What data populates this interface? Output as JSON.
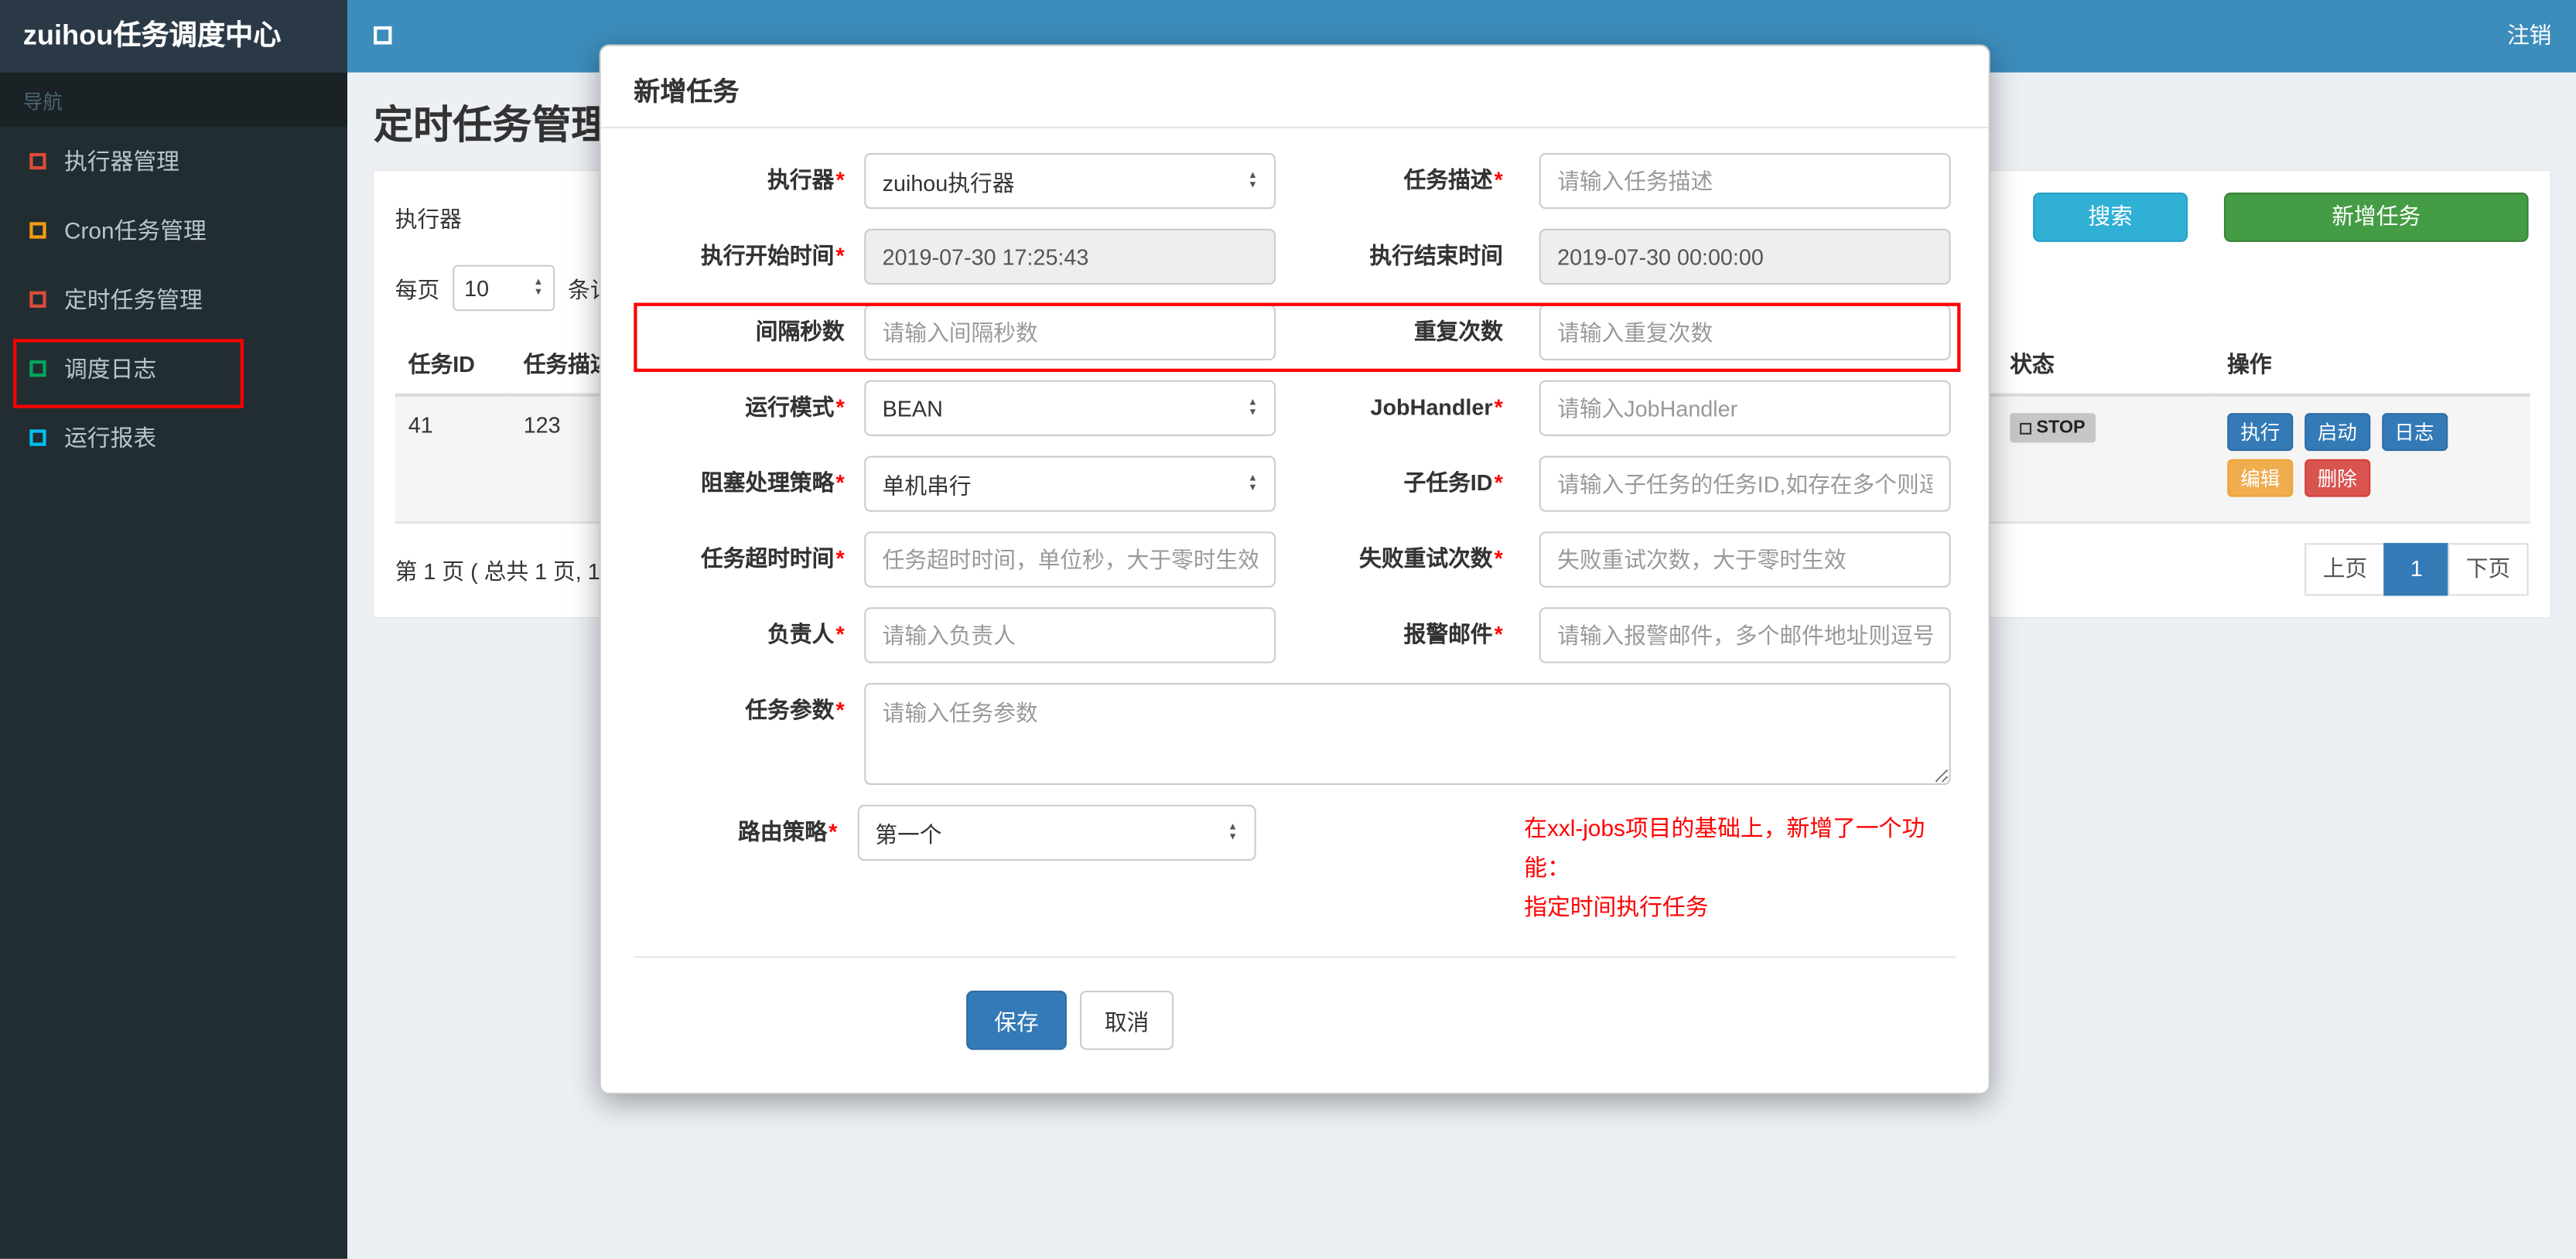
{
  "colors": {
    "navbar": "#3c8dbc",
    "logo_bg": "#2b3947",
    "sidebar_bg": "#222d32",
    "content_bg": "#ecf0f5",
    "primary": "#337ab7",
    "search_button": "#31b0d5",
    "add_button": "#449d44",
    "warning": "#f0ad4e",
    "danger": "#d9534f",
    "annotation": "#ff0000"
  },
  "navbar": {
    "brand": "zuihou任务调度中心",
    "logout": "注销"
  },
  "sidebar": {
    "header": "导航",
    "items": [
      {
        "label": "执行器管理",
        "icon": "square-outline-icon",
        "icon_color": "#dd4b39"
      },
      {
        "label": "Cron任务管理",
        "icon": "square-outline-icon",
        "icon_color": "#f39c12"
      },
      {
        "label": "定时任务管理",
        "icon": "square-outline-icon",
        "icon_color": "#dd4b39",
        "highlighted": true
      },
      {
        "label": "调度日志",
        "icon": "square-outline-icon",
        "icon_color": "#00a65a"
      },
      {
        "label": "运行报表",
        "icon": "square-outline-icon",
        "icon_color": "#00c0ef"
      }
    ]
  },
  "page": {
    "title": "定时任务管理"
  },
  "toolbar": {
    "executor_label": "执行器",
    "search_button": "搜索",
    "add_button": "新增任务",
    "per_page_label": "每页",
    "per_page_value": "10",
    "records_suffix": "条记录"
  },
  "table": {
    "headers": [
      "任务ID",
      "任务描述",
      "状态",
      "操作"
    ],
    "row": {
      "id": "41",
      "desc": "123",
      "status": "STOP",
      "ops": [
        "执行",
        "启动",
        "日志",
        "编辑",
        "删除"
      ]
    }
  },
  "pagination": {
    "summary": "第 1 页 ( 总共 1 页, 1",
    "prev": "上页",
    "current": "1",
    "next": "下页"
  },
  "modal": {
    "title": "新增任务",
    "fields": {
      "executor": {
        "label": "执行器",
        "required": true,
        "value": "zuihou执行器"
      },
      "job_desc": {
        "label": "任务描述",
        "required": true,
        "placeholder": "请输入任务描述"
      },
      "start_time": {
        "label": "执行开始时间",
        "required": true,
        "value": "2019-07-30 17:25:43"
      },
      "end_time": {
        "label": "执行结束时间",
        "required": false,
        "value": "2019-07-30 00:00:00"
      },
      "interval": {
        "label": "间隔秒数",
        "required": false,
        "placeholder": "请输入间隔秒数"
      },
      "repeat": {
        "label": "重复次数",
        "required": false,
        "placeholder": "请输入重复次数"
      },
      "run_mode": {
        "label": "运行模式",
        "required": true,
        "value": "BEAN"
      },
      "job_handler": {
        "label": "JobHandler",
        "required": true,
        "placeholder": "请输入JobHandler"
      },
      "block_strategy": {
        "label": "阻塞处理策略",
        "required": true,
        "value": "单机串行"
      },
      "child_job": {
        "label": "子任务ID",
        "required": true,
        "placeholder": "请输入子任务的任务ID,如存在多个则逗号分隔"
      },
      "timeout": {
        "label": "任务超时时间",
        "required": true,
        "placeholder": "任务超时时间，单位秒，大于零时生效"
      },
      "retry": {
        "label": "失败重试次数",
        "required": true,
        "placeholder": "失败重试次数，大于零时生效"
      },
      "owner": {
        "label": "负责人",
        "required": true,
        "placeholder": "请输入负责人"
      },
      "alarm_email": {
        "label": "报警邮件",
        "required": true,
        "placeholder": "请输入报警邮件，多个邮件地址则逗号分隔"
      },
      "job_param": {
        "label": "任务参数",
        "required": true,
        "placeholder": "请输入任务参数"
      },
      "route_strategy": {
        "label": "路由策略",
        "required": true,
        "value": "第一个"
      }
    },
    "note_line1": "在xxl-jobs项目的基础上，新增了一个功能：",
    "note_line2": "指定时间执行任务",
    "save_button": "保存",
    "cancel_button": "取消"
  }
}
